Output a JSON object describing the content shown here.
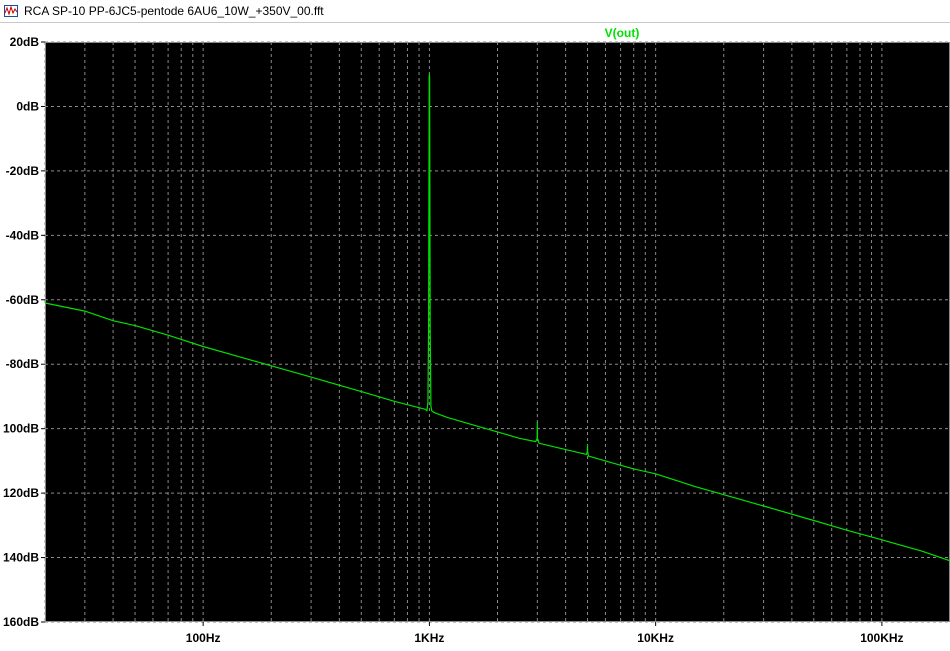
{
  "window": {
    "title": "RCA SP-10 PP-6JC5-pentode 6AU6_10W_+350V_00.fft",
    "icon": "waveform-file-icon"
  },
  "colors": {
    "plot_background": "#000000",
    "grid": "#8a8a8a",
    "trace": "#00e000",
    "trace_label": "#00e000",
    "axis_text": "#000000"
  },
  "chart_data": {
    "type": "line",
    "title": "V(out)",
    "xscale": "log",
    "xlim": [
      20,
      200000
    ],
    "ylim": [
      -160,
      20
    ],
    "x_ticks": [
      {
        "value": 100,
        "label": "100Hz"
      },
      {
        "value": 1000,
        "label": "1KHz"
      },
      {
        "value": 10000,
        "label": "10KHz"
      },
      {
        "value": 100000,
        "label": "100KHz"
      }
    ],
    "y_ticks": [
      {
        "value": 20,
        "label": "20dB"
      },
      {
        "value": 0,
        "label": "0dB"
      },
      {
        "value": -20,
        "label": "-20dB"
      },
      {
        "value": -40,
        "label": "-40dB"
      },
      {
        "value": -60,
        "label": "-60dB"
      },
      {
        "value": -80,
        "label": "-80dB"
      },
      {
        "value": -100,
        "label": "100dB"
      },
      {
        "value": -120,
        "label": "120dB"
      },
      {
        "value": -140,
        "label": "140dB"
      },
      {
        "value": -160,
        "label": "160dB"
      }
    ],
    "grid": true,
    "series": [
      {
        "name": "V(out)",
        "x": [
          20,
          30,
          40,
          50,
          70,
          100,
          150,
          200,
          300,
          500,
          700,
          900,
          960,
          975,
          985,
          992,
          996,
          998,
          1000,
          1002,
          1004,
          1008,
          1015,
          1025,
          1050,
          1200,
          1500,
          2000,
          2500,
          2950,
          2995,
          3000,
          3005,
          3050,
          3500,
          4000,
          4950,
          4995,
          5000,
          5005,
          5050,
          6000,
          8000,
          10000,
          15000,
          20000,
          30000,
          50000,
          70000,
          100000,
          150000,
          200000
        ],
        "y": [
          -61,
          -63.5,
          -66.5,
          -68,
          -71,
          -74.5,
          -78,
          -80.5,
          -84,
          -88.5,
          -91.5,
          -93.5,
          -94,
          -94.5,
          -92,
          -69,
          -17,
          9,
          10,
          9,
          -17,
          -69,
          -93,
          -94.5,
          -95,
          -96.5,
          -98.5,
          -101,
          -103,
          -104,
          -103,
          -98,
          -103,
          -104.5,
          -105.5,
          -106.5,
          -108,
          -107,
          -105,
          -107,
          -108.5,
          -110,
          -112.5,
          -114,
          -118,
          -120.5,
          -124,
          -128.5,
          -131.5,
          -134.5,
          -138,
          -141
        ]
      }
    ]
  }
}
